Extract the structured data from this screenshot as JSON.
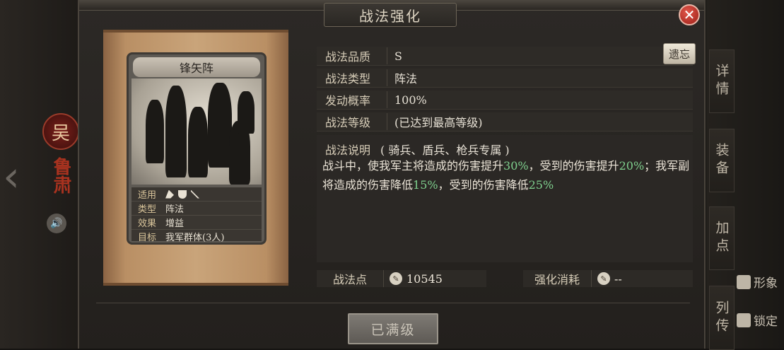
{
  "window": {
    "title": "战法强化",
    "close_icon": "close-icon"
  },
  "background": {
    "faction": "吴",
    "hero_name": "鲁肃",
    "side_tabs": [
      "详情",
      "装备",
      "加点",
      "列传"
    ],
    "right_options": [
      {
        "label": "形象",
        "icon": "figure-icon"
      },
      {
        "label": "锁定",
        "icon": "lock-icon"
      }
    ]
  },
  "card": {
    "name": "锋矢阵",
    "info": [
      {
        "key": "适用",
        "value": ""
      },
      {
        "key": "类型",
        "value": "阵法"
      },
      {
        "key": "效果",
        "value": "增益"
      },
      {
        "key": "目标",
        "value": "我军群体(3人)"
      }
    ],
    "applicable_icons": [
      "cavalry-icon",
      "shield-icon",
      "spear-icon"
    ]
  },
  "attributes": [
    {
      "key": "战法品质",
      "value": "S"
    },
    {
      "key": "战法类型",
      "value": "阵法"
    },
    {
      "key": "发动概率",
      "value": "100%"
    },
    {
      "key": "战法等级",
      "value": "(已达到最高等级)"
    }
  ],
  "legacy_button": "遗忘",
  "description": {
    "label": "战法说明",
    "tag": "( 骑兵、盾兵、枪兵专属 )",
    "parts": [
      {
        "t": "战斗中，使我军主将造成的伤害提升",
        "hl": false
      },
      {
        "t": "30%",
        "hl": true
      },
      {
        "t": "，受到的伤害提升",
        "hl": false
      },
      {
        "t": "20%",
        "hl": true
      },
      {
        "t": "；我军副将造成的伤害降低",
        "hl": false
      },
      {
        "t": "15%",
        "hl": true
      },
      {
        "t": "，受到的伤害降低",
        "hl": false
      },
      {
        "t": "25%",
        "hl": true
      }
    ]
  },
  "points": {
    "label": "战法点",
    "value": "10545"
  },
  "cost": {
    "label": "强化消耗",
    "value": "--"
  },
  "max_button": "已满级",
  "colors": {
    "highlight": "#7fd08e",
    "close": "#c8362b"
  }
}
